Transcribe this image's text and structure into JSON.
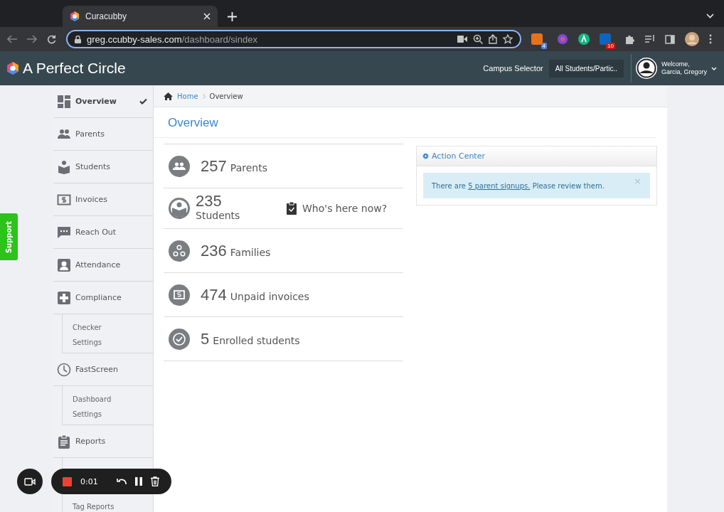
{
  "browser": {
    "tab_title": "Curacubby",
    "url_host": "greg.ccubby-sales.com",
    "url_path": "/dashboard/sindex",
    "extension_badges": [
      "4",
      "10"
    ]
  },
  "header": {
    "brand": "A Perfect Circle",
    "campus_label": "Campus Selector",
    "campus_value": "All Students/Partic..",
    "welcome": "Welcome,",
    "user": "Garcia, Gregory"
  },
  "support_tab": "Support",
  "sidebar": {
    "items": [
      {
        "label": "Overview",
        "selected": true
      },
      {
        "label": "Parents",
        "selected": false
      },
      {
        "label": "Students",
        "selected": false
      },
      {
        "label": "Invoices",
        "selected": false
      },
      {
        "label": "Reach Out",
        "selected": false
      },
      {
        "label": "Attendance",
        "selected": false
      },
      {
        "label": "Compliance",
        "selected": false,
        "children": [
          {
            "label": "Checker"
          },
          {
            "label": "Settings"
          }
        ]
      },
      {
        "label": "FastScreen",
        "selected": false,
        "children": [
          {
            "label": "Dashboard"
          },
          {
            "label": "Settings"
          }
        ]
      },
      {
        "label": "Reports",
        "selected": false,
        "children": [
          {
            "label": "Tag Reports"
          }
        ]
      }
    ]
  },
  "breadcrumb": [
    "Home",
    "Overview"
  ],
  "page_title": "Overview",
  "stats": [
    {
      "kind": "inline",
      "number": "257",
      "label": "Parents"
    },
    {
      "kind": "stacked",
      "number": "235",
      "label": "Students",
      "link": "Who's here now?"
    },
    {
      "kind": "inline",
      "number": "236",
      "label": "Families"
    },
    {
      "kind": "inline",
      "number": "474",
      "label": "Unpaid invoices"
    },
    {
      "kind": "inline",
      "number": "5",
      "label": "Enrolled students"
    }
  ],
  "action_center": {
    "title": "Action Center",
    "alert_before": "There are",
    "alert_link": "5 parent signups.",
    "alert_after": "Please review them.",
    "close": "×"
  },
  "recorder": {
    "time": "0:01"
  }
}
